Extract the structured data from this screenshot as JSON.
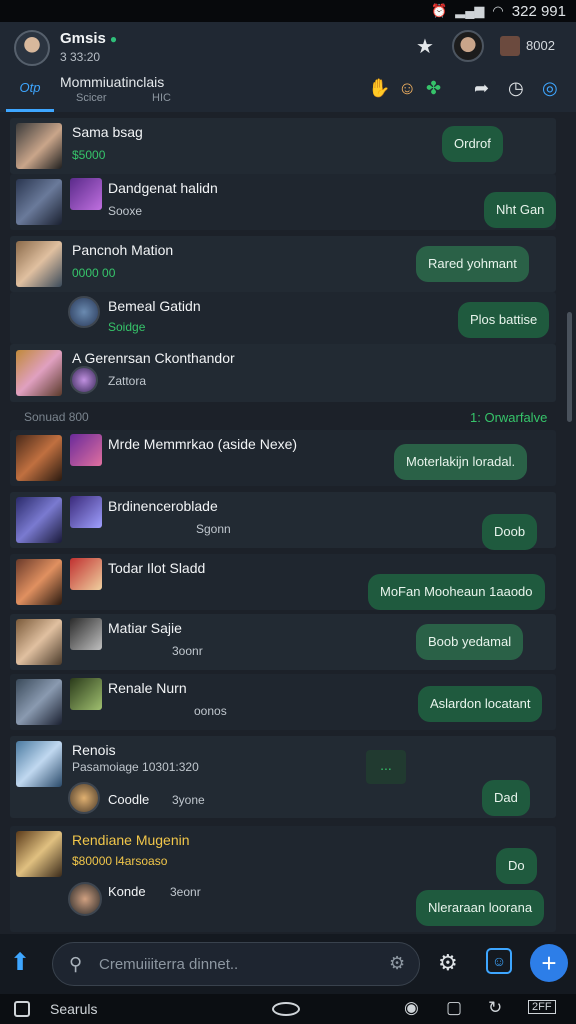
{
  "status_bar": {
    "time": "322 991",
    "icons": [
      "alarm",
      "signal",
      "wifi",
      "battery"
    ]
  },
  "header": {
    "title": "Gmsis",
    "subtitle": "3 33:20",
    "count": "8002",
    "tab_active_label": "Otp",
    "tab_main": "Mommiuatinclais",
    "tab_sub1": "Scicer",
    "tab_sub2": "HIC"
  },
  "rows": [
    {
      "name": "Sama bsag",
      "meta": "$5000",
      "bubble": "Ordrof"
    },
    {
      "name": "Dandgenat halidn",
      "meta": "Sooxe",
      "bubble": "Nht Gan"
    },
    {
      "name": "Pancnoh Mation",
      "meta": "0000 00",
      "bubble": "Rared yohmant"
    },
    {
      "name": "Bemeal Gatidn",
      "meta": "Soidge",
      "bubble": "Plos battise"
    },
    {
      "name": "A Gerenrsan Ckonthandor",
      "meta": "Zattora"
    }
  ],
  "divider": {
    "left": "Sonuad 800",
    "right": "1: Orwarfalve"
  },
  "rows2": [
    {
      "name": "Mrde Memmrkao (aside Nexe)",
      "bubble": "Moterlakijn loradal."
    },
    {
      "name": "Brdinenceroblade",
      "meta": "Sgonn",
      "bubble": "Doob"
    },
    {
      "name": "Todar Ilot Sladd",
      "bubble": "MoFan Mooheaun 1aaodo"
    },
    {
      "name": "Matiar Sajie",
      "meta": "3oonr",
      "bubble": "Boob yedamal"
    },
    {
      "name": "Renale Nurn",
      "meta": "oonos",
      "bubble": "Aslardon locatant"
    },
    {
      "name": "Renois",
      "meta": "Pasamoiage 10301:320",
      "sub_name": "Coodle",
      "sub_meta": "3yone",
      "bubble": "Dad"
    },
    {
      "name": "Rendiane Mugenin",
      "meta": "$80000 l4arsoaso",
      "sub_name": "Konde",
      "sub_meta": "3eonr",
      "bubble": "Do",
      "bubble2": "Nleraraan loorana"
    }
  ],
  "typing": "...",
  "composer": {
    "placeholder": "Cremuiiiterra dinnet.."
  },
  "nav_bar": {
    "label": "Searuls",
    "badge": "2FF"
  }
}
